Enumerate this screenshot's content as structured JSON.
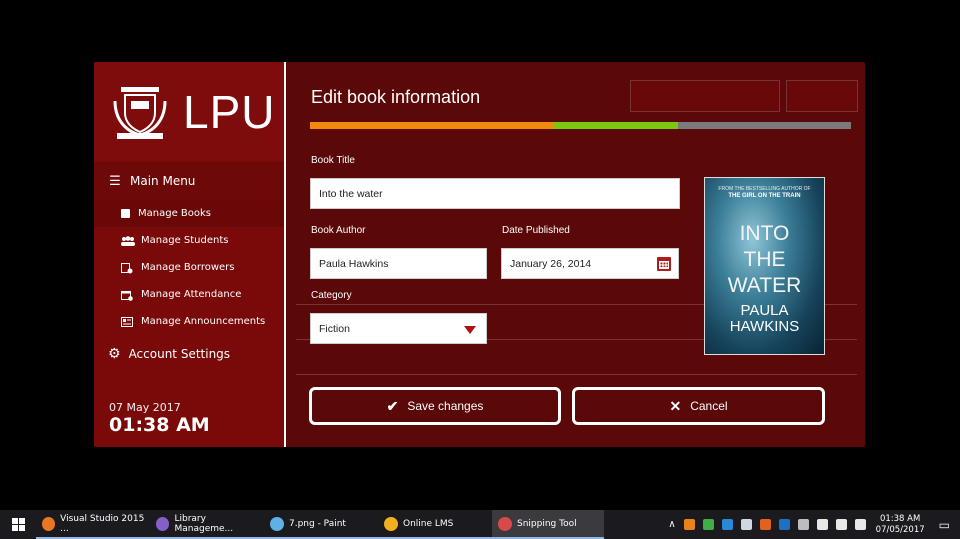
{
  "sidebar": {
    "brand": "LPU",
    "menu_title": "Main Menu",
    "items": [
      {
        "label": "Manage Books",
        "icon": "book-icon"
      },
      {
        "label": "Manage Students",
        "icon": "students-icon"
      },
      {
        "label": "Manage Borrowers",
        "icon": "borrowers-icon"
      },
      {
        "label": "Manage Attendance",
        "icon": "attendance-icon"
      },
      {
        "label": "Manage Announcements",
        "icon": "announcements-icon"
      }
    ],
    "account_settings": "Account Settings",
    "date": "07 May 2017",
    "time": "01:38 AM"
  },
  "dialog": {
    "title": "Edit book information",
    "progress": {
      "orange": 0.45,
      "green": 0.23,
      "gray": 0.32
    },
    "book_title_label": "Book Title",
    "book_title_value": "Into the water",
    "book_author_label": "Book Author",
    "book_author_value": "Paula Hawkins",
    "date_published_label": "Date Published",
    "date_published_value": "January 26, 2014",
    "category_label": "Category",
    "category_value": "Fiction",
    "cover": {
      "top_line": "FROM THE BESTSELLING AUTHOR OF",
      "top_title": "THE GIRL ON THE TRAIN",
      "title_1": "INTO",
      "title_2": "THE",
      "title_3": "WATER",
      "author_1": "PAULA",
      "author_2": "HAWKINS"
    },
    "save_label": "Save changes",
    "cancel_label": "Cancel"
  },
  "taskbar": {
    "apps": [
      {
        "label": "Visual Studio 2015 ...",
        "color": "#e87722"
      },
      {
        "label": "Library Manageme...",
        "color": "#865fc5"
      },
      {
        "label": "7.png - Paint",
        "color": "#5fb0e8"
      },
      {
        "label": "Online LMS",
        "color": "#f2b01e"
      },
      {
        "label": "Snipping Tool",
        "color": "#d84a4a"
      }
    ],
    "clock_time": "01:38 AM",
    "clock_date": "07/05/2017"
  },
  "colors": {
    "accent": "#7a0a0a",
    "progress_orange": "#f08a0f",
    "progress_green": "#7cc80f",
    "progress_gray": "#7a7a7a"
  }
}
